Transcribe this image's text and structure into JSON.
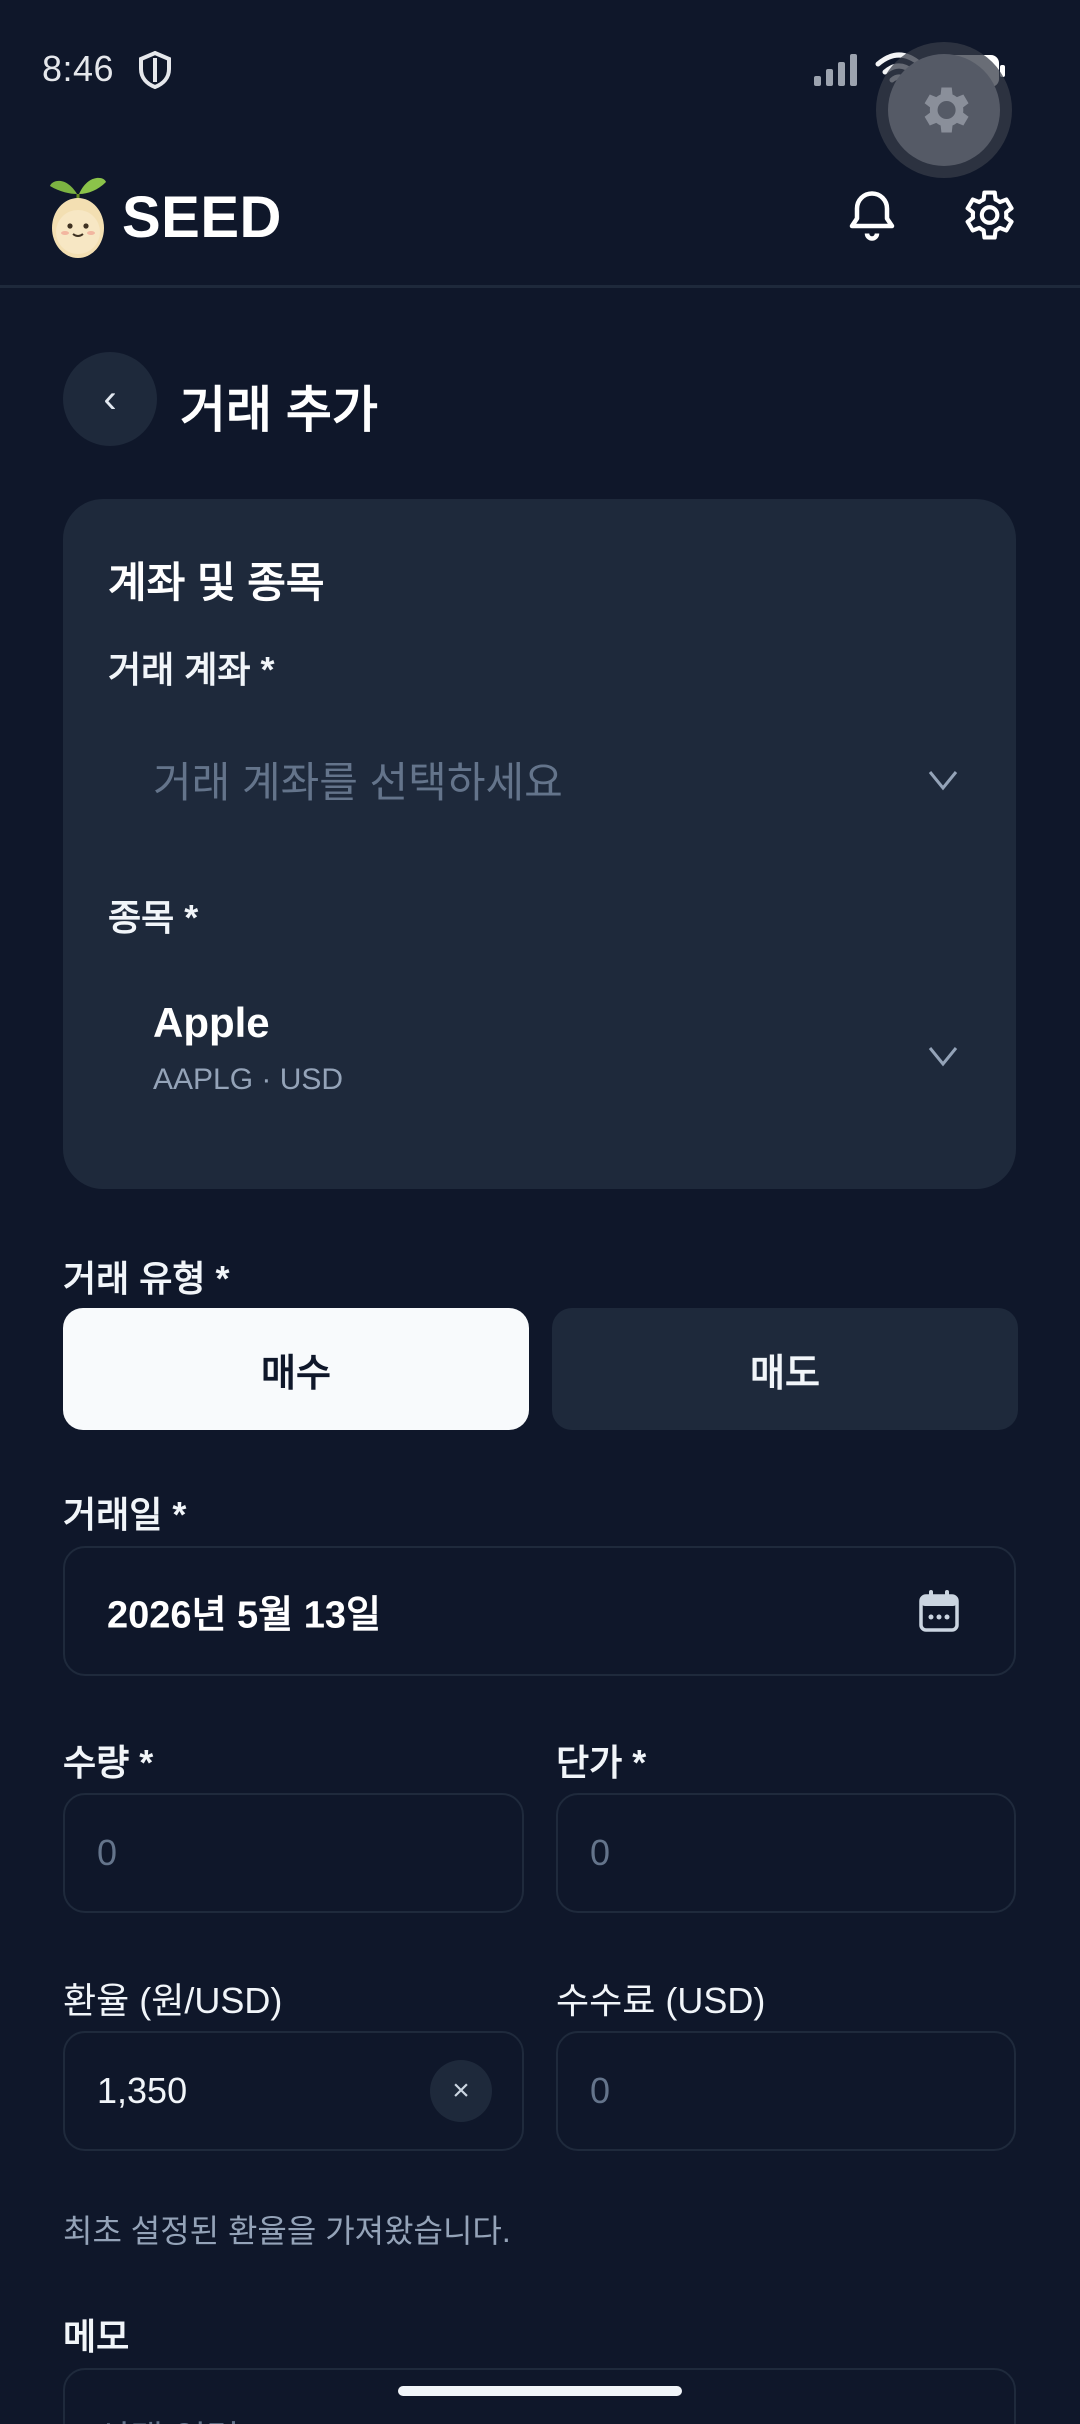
{
  "status_bar": {
    "time": "8:46"
  },
  "app_bar": {
    "brand": "SEED"
  },
  "page": {
    "title": "거래 추가",
    "back_symbol": "‹"
  },
  "account_card": {
    "title": "계좌 및 종목",
    "account_label": "거래 계좌 *",
    "account_placeholder": "거래 계좌를 선택하세요",
    "stock_label": "종목 *",
    "stock_name": "Apple",
    "stock_sub": "AAPLG · USD"
  },
  "trade_type": {
    "label": "거래 유형 *",
    "buy": "매수",
    "sell": "매도",
    "selected": "매수"
  },
  "trade_date": {
    "label": "거래일 *",
    "value": "2026년 5월 13일"
  },
  "quantity": {
    "label": "수량 *",
    "placeholder": "0"
  },
  "unit_price": {
    "label": "단가 *",
    "placeholder": "0"
  },
  "exchange_rate": {
    "label": "환율 (원/USD)",
    "value": "1,350",
    "clear_symbol": "×"
  },
  "fee": {
    "label": "수수료 (USD)",
    "placeholder": "0"
  },
  "helper_text": "최초 설정된 환율을 가져왔습니다.",
  "memo": {
    "label": "메모",
    "placeholder": "선택 입력"
  },
  "colors": {
    "background": "#0f172a",
    "card": "#1e293b",
    "selected_toggle": "#f8fafc",
    "muted_text": "#94a3b8"
  },
  "icons": [
    "shield-icon",
    "signal-icon",
    "wifi-icon",
    "battery-icon",
    "gear-icon",
    "seed-logo",
    "bell-icon",
    "chevron-down-icon",
    "calendar-icon",
    "close-icon"
  ]
}
